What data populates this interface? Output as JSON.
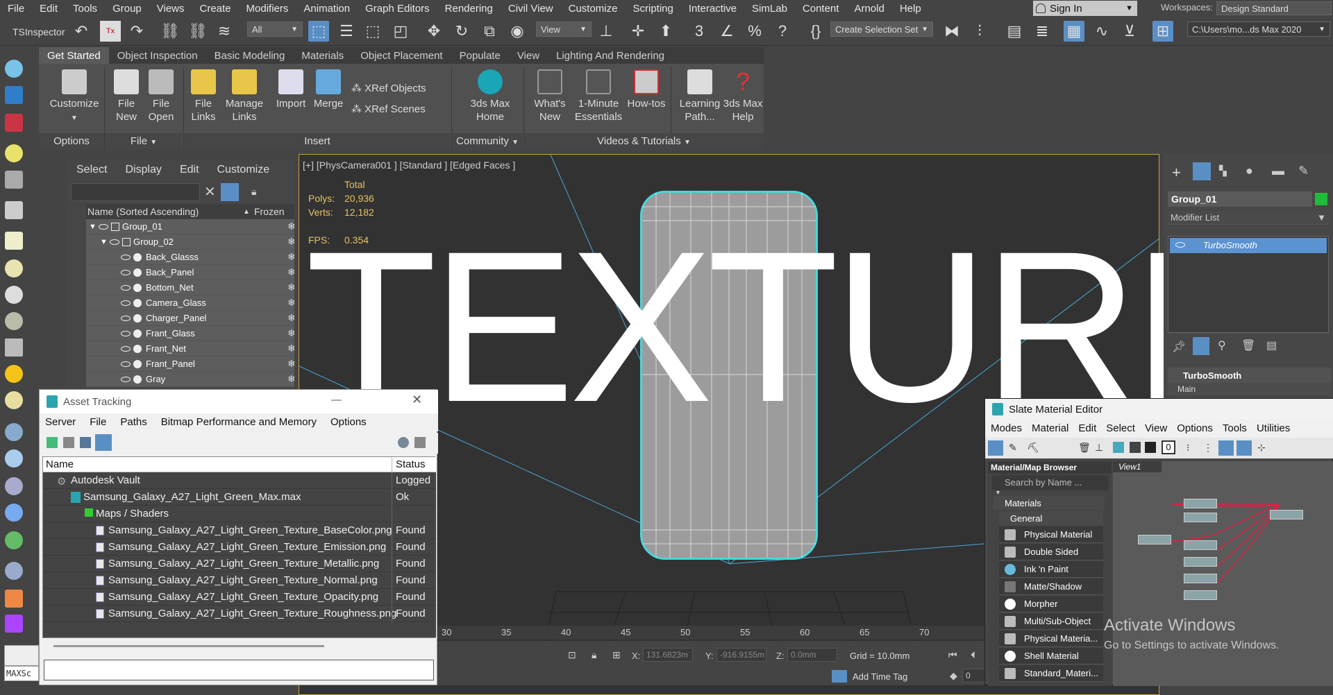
{
  "menubar": [
    "File",
    "Edit",
    "Tools",
    "Group",
    "Views",
    "Create",
    "Modifiers",
    "Animation",
    "Graph Editors",
    "Rendering",
    "Civil View",
    "Customize",
    "Scripting",
    "Interactive",
    "SimLab",
    "Content",
    "Arnold",
    "Help"
  ],
  "signin": "Sign In",
  "workspace": {
    "label": "Workspaces:",
    "value": "Design Standard"
  },
  "toolbar": {
    "tsinspector": "TSInspector",
    "filter": "All",
    "view": "View",
    "selection_set": "Create Selection Set",
    "path": "C:\\Users\\mo...ds Max 2020"
  },
  "ribbon": {
    "tabs": [
      "Get Started",
      "Object Inspection",
      "Basic Modeling",
      "Materials",
      "Object Placement",
      "Populate",
      "View",
      "Lighting And Rendering"
    ],
    "buttons": {
      "customize": "Customize",
      "file_new": "File\nNew",
      "file_open": "File\nOpen",
      "file_links": "File\nLinks",
      "manage_links": "Manage\nLinks",
      "import": "Import",
      "merge": "Merge",
      "xref_objects": "XRef Objects",
      "xref_scenes": "XRef Scenes",
      "max_home": "3ds Max\nHome",
      "whats_new": "What's\nNew",
      "essentials": "1-Minute\nEssentials",
      "howtos": "How-tos",
      "learning": "Learning\nPath...",
      "help": "3ds Max\nHelp"
    },
    "groups": {
      "options": "Options",
      "file": "File",
      "insert": "Insert",
      "community": "Community",
      "videos": "Videos & Tutorials"
    }
  },
  "scene_explorer": {
    "menu": [
      "Select",
      "Display",
      "Edit",
      "Customize"
    ],
    "col_name": "Name (Sorted Ascending)",
    "col_frozen": "Frozen",
    "rows": [
      "Group_01",
      "Group_02",
      "Back_Glasss",
      "Back_Panel",
      "Bottom_Net",
      "Camera_Glass",
      "Charger_Panel",
      "Frant_Glass",
      "Frant_Net",
      "Frant_Panel",
      "Gray"
    ]
  },
  "viewport": {
    "label": "[+] [PhysCamera001 ] [Standard ] [Edged Faces ]",
    "total": "Total",
    "polys_label": "Polys:",
    "polys": "20,936",
    "verts_label": "Verts:",
    "verts": "12,182",
    "fps_label": "FPS:",
    "fps": "0.354",
    "overlay": "TEXTURE"
  },
  "command_panel": {
    "object": "Group_01",
    "modifier_list": "Modifier List",
    "stack_item": "TurboSmooth",
    "rollout": "TurboSmooth",
    "rollout_main": "Main"
  },
  "timeline_ticks": [
    "30",
    "35",
    "40",
    "45",
    "50",
    "55",
    "60",
    "65",
    "70"
  ],
  "status": {
    "x_label": "X:",
    "x": "131.6823m",
    "y_label": "Y:",
    "y": "-916.9155m",
    "z_label": "Z:",
    "z": "0.0mm",
    "grid": "Grid = 10.0mm",
    "add_time_tag": "Add Time Tag",
    "frame": "0",
    "maxscript": "MAXSc"
  },
  "asset_tracking": {
    "title": "Asset Tracking",
    "menu": [
      "Server",
      "File",
      "Paths",
      "Bitmap Performance and Memory",
      "Options"
    ],
    "col_name": "Name",
    "col_status": "Status",
    "rows": [
      {
        "name": "Autodesk Vault",
        "status": "Logged"
      },
      {
        "name": "Samsung_Galaxy_A27_Light_Green_Max.max",
        "status": "Ok"
      },
      {
        "name": "Maps / Shaders",
        "status": ""
      },
      {
        "name": "Samsung_Galaxy_A27_Light_Green_Texture_BaseColor.png",
        "status": "Found"
      },
      {
        "name": "Samsung_Galaxy_A27_Light_Green_Texture_Emission.png",
        "status": "Found"
      },
      {
        "name": "Samsung_Galaxy_A27_Light_Green_Texture_Metallic.png",
        "status": "Found"
      },
      {
        "name": "Samsung_Galaxy_A27_Light_Green_Texture_Normal.png",
        "status": "Found"
      },
      {
        "name": "Samsung_Galaxy_A27_Light_Green_Texture_Opacity.png",
        "status": "Found"
      },
      {
        "name": "Samsung_Galaxy_A27_Light_Green_Texture_Roughness.png",
        "status": "Found"
      }
    ]
  },
  "slate": {
    "title": "Slate Material Editor",
    "menu": [
      "Modes",
      "Material",
      "Edit",
      "Select",
      "View",
      "Options",
      "Tools",
      "Utilities"
    ],
    "browser_title": "Material/Map Browser",
    "search": "Search by Name ...",
    "materials": "Materials",
    "general": "General",
    "items": [
      "Physical Material",
      "Double Sided",
      "Ink 'n Paint",
      "Matte/Shadow",
      "Morpher",
      "Multi/Sub-Object",
      "Physical Materia...",
      "Shell Material",
      "Standard_Materi..."
    ],
    "view_tab": "View1",
    "tb_num": "0"
  },
  "watermark": {
    "line1": "Activate Windows",
    "line2": "Go to Settings to activate Windows."
  }
}
